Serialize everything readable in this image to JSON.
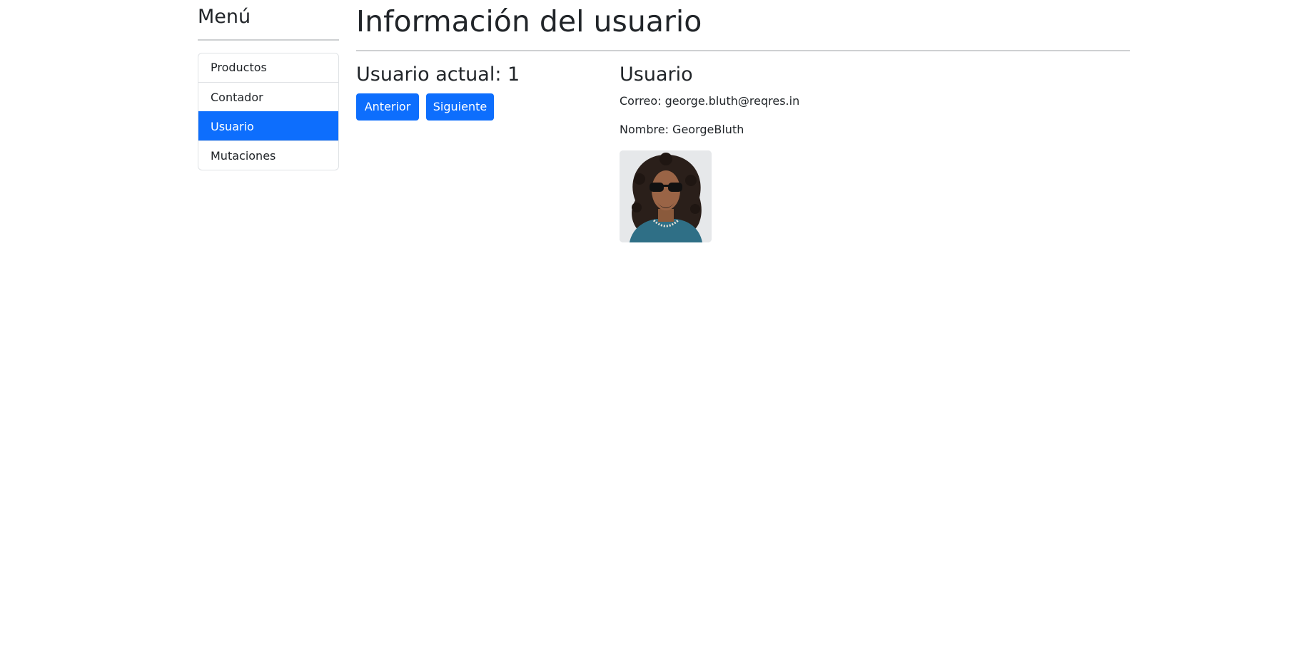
{
  "sidebar": {
    "title": "Menú",
    "items": [
      {
        "label": "Productos",
        "active": false
      },
      {
        "label": "Contador",
        "active": false
      },
      {
        "label": "Usuario",
        "active": true
      },
      {
        "label": "Mutaciones",
        "active": false
      }
    ]
  },
  "main": {
    "title": "Información del usuario",
    "current_user_label": "Usuario actual: 1",
    "prev_button": "Anterior",
    "next_button": "Siguiente"
  },
  "user": {
    "heading": "Usuario",
    "email_text": "Correo: george.bluth@reqres.in",
    "name_text": "Nombre: GeorgeBluth"
  },
  "colors": {
    "primary": "#0d6efd",
    "text": "#212529",
    "border": "#dfe2e5"
  }
}
